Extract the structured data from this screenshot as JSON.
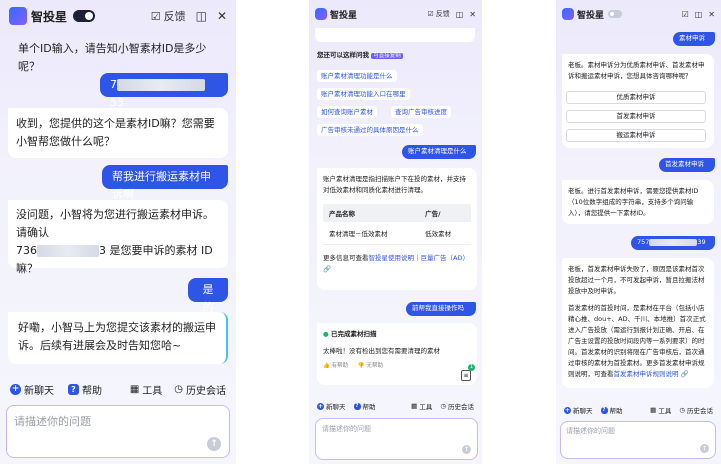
{
  "app": {
    "title": "智投星",
    "feedback": "反馈"
  },
  "panel1": {
    "messages": [
      {
        "role": "bot",
        "text": "单个ID输入，请告知小智素材ID是多少呢？"
      },
      {
        "role": "user",
        "prefix": "7",
        "suffix": "53"
      },
      {
        "role": "bot",
        "text": "收到，您提供的这个是素材ID嘛？您需要小智帮您做什么呢？"
      },
      {
        "role": "user",
        "text": "帮我进行搬运素材申诉啊"
      },
      {
        "role": "bot",
        "line1": "没问题，小智将为您进行搬运素材申诉。请确认",
        "prefix": "736",
        "suffix": "3 是您要申诉的素材 ID",
        "line3": "嘛？"
      },
      {
        "role": "user",
        "text": "是的"
      },
      {
        "role": "bot",
        "text": "好嘞，小智马上为您提交该素材的搬运申诉。后续有进展会及时告知您哈~"
      }
    ]
  },
  "panel2": {
    "intro": "您还可以这样问我",
    "tag": "可直接复制",
    "suggestions": [
      "账户素材清理功能是什么",
      "账户素材清理功能入口在哪里",
      "如何查询账户素材",
      "查询广告审核进度",
      "广告审核未通过的具体原因是什么"
    ],
    "q1": "账户素材清理是什么",
    "answer1": "账户素材清理是指扫描账户下在投的素材，并支持对低效素材和同质化素材进行清理。",
    "table": {
      "headers": [
        "产品名称",
        "广告/"
      ],
      "row": [
        "素材清理－低效素材",
        "低效素材"
      ]
    },
    "more_prefix": "更多信息可查看",
    "more_link1": "智投星使用说明",
    "more_sep": "｜",
    "more_link2": "巨量广告（AD）",
    "q2": "前帮我直接操作吗",
    "done": "已完成素材扫描",
    "done_text": "太棒啦！没有检出到您有需要清理的素材",
    "like": "有帮助",
    "dislike": "无帮助",
    "badge": "1"
  },
  "panel3": {
    "q1": "素材申诉",
    "a1": "老板。素材申诉分为优质素材申诉、首发素材申诉和搬运素材申诉，您想具体咨询哪种呢？",
    "options": [
      "优质素材申诉",
      "首发素材申诉",
      "搬运素材申诉"
    ],
    "q2": "首发素材申诉",
    "a2": "老板。进行首发素材申诉，需要您提供素材ID（10位数字组成的字符串，支持多个询问输入），请您提供一下素材ID。",
    "q3_prefix": "757",
    "q3_suffix": "39",
    "a3_p1": "老板，首发素材申诉失败了，原因是该素材首次投放超过一个月，不可发起申诉，暂且拉搬法材投放中及时申诉。",
    "a3_p2": "首发素材的首投时间，是素材在平台（包括小店精心推、dou+、AD、千川、本地推）首次正式进入广告投放（需运行到报计划正确、开启、在广告主设置的投放时间段内等一系列要求）的时间。首发素材的识别将限在广告审核后，首次通过审核的素材为首投素材。更多首发素材申诉规则说明，可查看",
    "a3_link": "首发素材申诉规则说明"
  },
  "footer": {
    "new_chat": "新聊天",
    "help": "帮助",
    "tools": "工具",
    "history": "历史会话",
    "placeholder": "请描述你的问题"
  },
  "colors": {
    "accent": "#2f55e6",
    "panel_bg": "#f2f1fc"
  }
}
